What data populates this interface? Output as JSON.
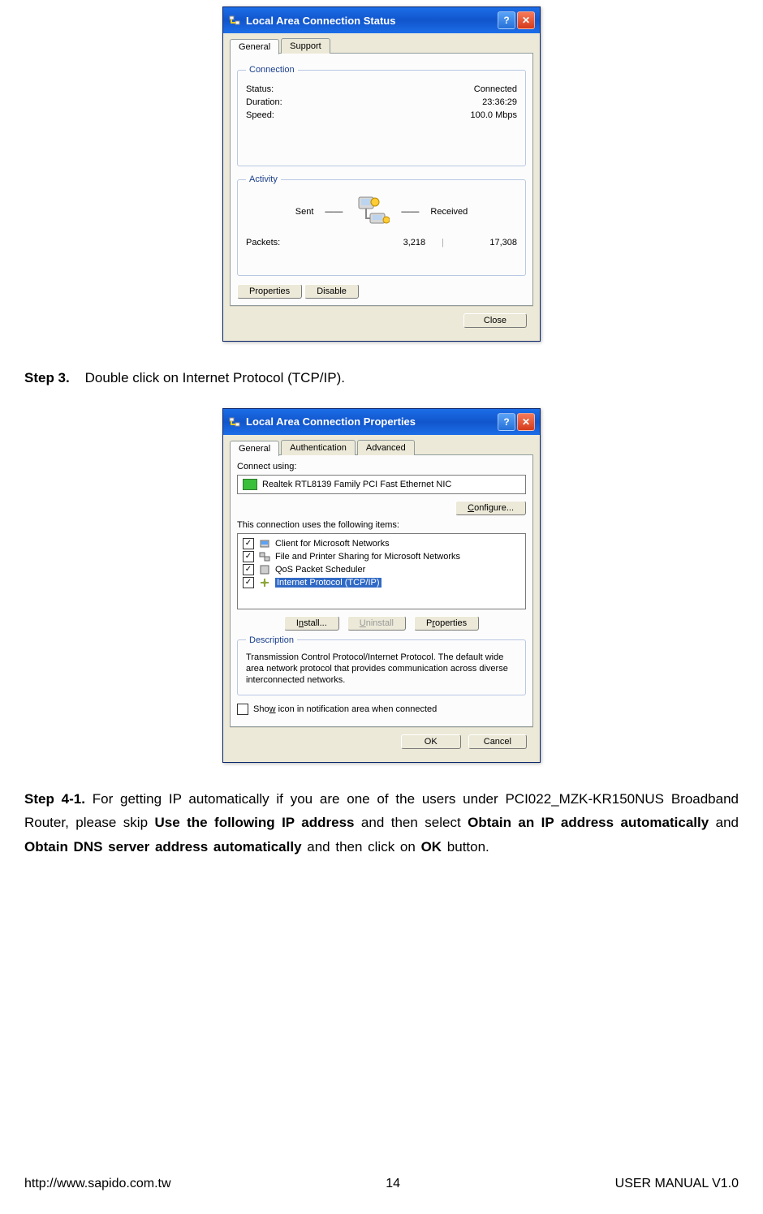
{
  "status_window": {
    "title": "Local Area Connection Status",
    "tabs": [
      "General",
      "Support"
    ],
    "connection": {
      "legend": "Connection",
      "status_label": "Status:",
      "status_value": "Connected",
      "duration_label": "Duration:",
      "duration_value": "23:36:29",
      "speed_label": "Speed:",
      "speed_value": "100.0 Mbps"
    },
    "activity": {
      "legend": "Activity",
      "sent_label": "Sent",
      "received_label": "Received",
      "packets_label": "Packets:",
      "sent_value": "3,218",
      "received_value": "17,308"
    },
    "buttons": {
      "properties": "Properties",
      "disable": "Disable",
      "close": "Close"
    }
  },
  "step3": {
    "label": "Step 3.",
    "text": "Double click on Internet Protocol (TCP/IP)."
  },
  "props_window": {
    "title": "Local Area Connection Properties",
    "tabs": [
      "General",
      "Authentication",
      "Advanced"
    ],
    "connect_using": "Connect using:",
    "adapter": "Realtek RTL8139 Family PCI Fast Ethernet NIC",
    "configure": "Configure...",
    "uses_items": "This connection uses the following items:",
    "items": [
      "Client for Microsoft Networks",
      "File and Printer Sharing for Microsoft Networks",
      "QoS Packet Scheduler",
      "Internet Protocol (TCP/IP)"
    ],
    "install": "Install...",
    "uninstall": "Uninstall",
    "properties": "Properties",
    "description_legend": "Description",
    "description": "Transmission Control Protocol/Internet Protocol. The default wide area network protocol that provides communication across diverse interconnected networks.",
    "show_icon": "Show icon in notification area when connected",
    "ok": "OK",
    "cancel": "Cancel"
  },
  "step41": {
    "label": "Step 4-1.",
    "part1": "For getting IP automatically if you are one of the users under PCI022_MZK-KR150NUS Broadband Router, please skip ",
    "bold1": "Use the following IP address",
    "part2": " and then select ",
    "bold2": "Obtain an IP address automatically",
    "part3": " and ",
    "bold3": "Obtain DNS server address automatically",
    "part4": " and then click on ",
    "bold4": "OK",
    "part5": " button."
  },
  "footer": {
    "url": "http://www.sapido.com.tw",
    "page": "14",
    "version": "USER MANUAL V1.0"
  }
}
